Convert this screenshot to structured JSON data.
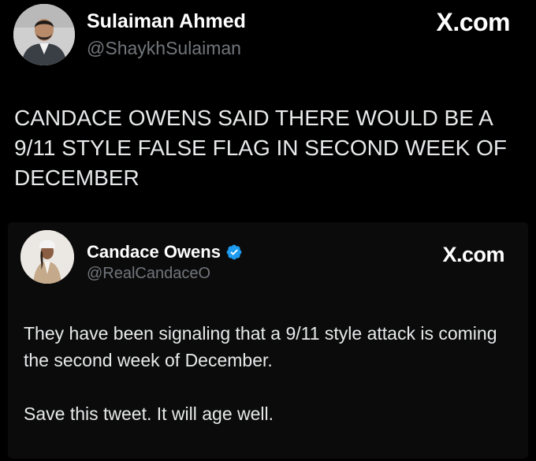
{
  "outer_tweet": {
    "author": {
      "display_name": "Sulaiman Ahmed",
      "handle": "@ShaykhSulaiman",
      "avatar_icon": "profile-photo"
    },
    "site_label": "X.com",
    "text": "CANDACE OWENS SAID THERE WOULD BE A 9/11 STYLE FALSE FLAG IN SECOND WEEK OF DECEMBER"
  },
  "quoted_tweet": {
    "author": {
      "display_name": "Candace Owens",
      "handle": "@RealCandaceO",
      "verified": true,
      "verified_icon": "verified-badge",
      "avatar_icon": "profile-photo"
    },
    "site_label": "X.com",
    "paragraphs": [
      "They have been signaling that a 9/11 style attack is coming the second week of December.",
      "Save this tweet. It will age well."
    ]
  },
  "colors": {
    "background": "#000000",
    "text": "#e7e9ea",
    "handle": "#71767b",
    "verified": "#1d9bf0"
  }
}
